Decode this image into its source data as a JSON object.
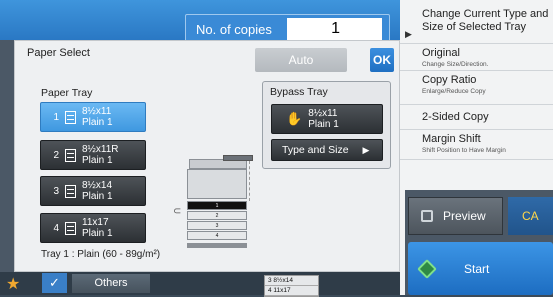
{
  "header": {
    "copies_label": "No. of copies",
    "copies_value": "1"
  },
  "right_panel": {
    "items": [
      {
        "title": "Change Current Type and Size of Selected Tray",
        "sub": ""
      },
      {
        "title": "Original",
        "sub": "Change Size/Direction."
      },
      {
        "title": "Copy Ratio",
        "sub": "Enlarge/Reduce Copy"
      },
      {
        "title": "2-Sided Copy",
        "sub": ""
      },
      {
        "title": "Margin Shift",
        "sub": "Shift Position to Have Margin"
      }
    ],
    "preview_label": "Preview",
    "ca_label": "CA",
    "start_label": "Start"
  },
  "bottom": {
    "others_label": "Others",
    "mini_trays": [
      "3  8½x14",
      "4  11x17"
    ]
  },
  "dialog": {
    "title": "Paper Select",
    "auto_label": "Auto",
    "ok_label": "OK",
    "paper_tray_title": "Paper Tray",
    "trays": [
      {
        "num": "1",
        "size": "8½x11",
        "type": "Plain 1",
        "selected": true
      },
      {
        "num": "2",
        "size": "8½x11R",
        "type": "Plain 1",
        "selected": false
      },
      {
        "num": "3",
        "size": "8½x14",
        "type": "Plain 1",
        "selected": false
      },
      {
        "num": "4",
        "size": "11x17",
        "type": "Plain 1",
        "selected": false
      }
    ],
    "tray_info": "Tray 1 : Plain (60 - 89g/m²)",
    "bypass": {
      "title": "Bypass Tray",
      "size": "8½x11",
      "type": "Plain 1",
      "type_size_label": "Type and Size"
    },
    "machine_drawers": [
      "1",
      "2",
      "3",
      "4"
    ]
  },
  "colors": {
    "selected_tray": "#4ea7ea",
    "ok_button": "#2b7fd1",
    "start_button": "#2a82d6"
  }
}
